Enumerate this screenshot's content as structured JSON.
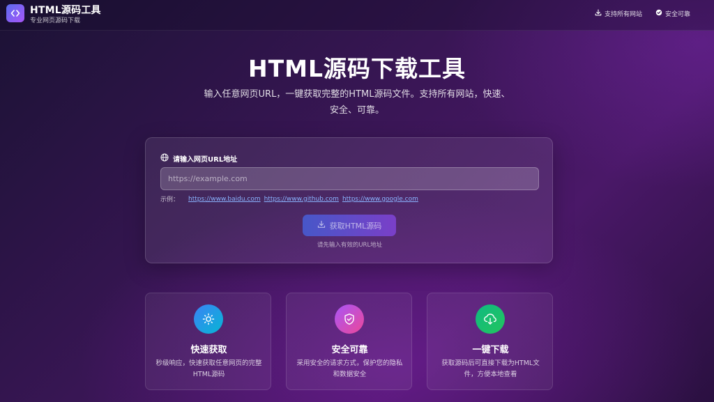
{
  "header": {
    "brand_title": "HTML源码工具",
    "brand_subtitle": "专业网页源码下载",
    "nav": {
      "support_label": "支持所有网站",
      "safe_label": "安全可靠"
    }
  },
  "hero": {
    "title": "HTML源码下载工具",
    "description": "输入任意网页URL，一键获取完整的HTML源码文件。支持所有网站，快速、安全、可靠。"
  },
  "form": {
    "url_label": "请输入网页URL地址",
    "url_placeholder": "https://example.com",
    "url_value": "",
    "examples_label": "示例：",
    "examples": [
      "https://www.baidu.com",
      "https://www.github.com",
      "https://www.google.com"
    ],
    "submit_label": "获取HTML源码",
    "hint": "请先输入有效的URL地址"
  },
  "features": [
    {
      "icon": "sun-icon",
      "title": "快速获取",
      "description": "秒级响应，快速获取任意网页的完整HTML源码"
    },
    {
      "icon": "shield-check-icon",
      "title": "安全可靠",
      "description": "采用安全的请求方式，保护您的隐私和数据安全"
    },
    {
      "icon": "cloud-download-icon",
      "title": "一键下载",
      "description": "获取源码后可直接下载为HTML文件，方便本地查看"
    }
  ],
  "colors": {
    "accent_start": "#4757c8",
    "accent_end": "#7a3fc8",
    "link": "#8ab4ff",
    "feature_blue": "#3b82f6",
    "feature_pink": "#ec4899",
    "feature_green": "#10b981"
  }
}
